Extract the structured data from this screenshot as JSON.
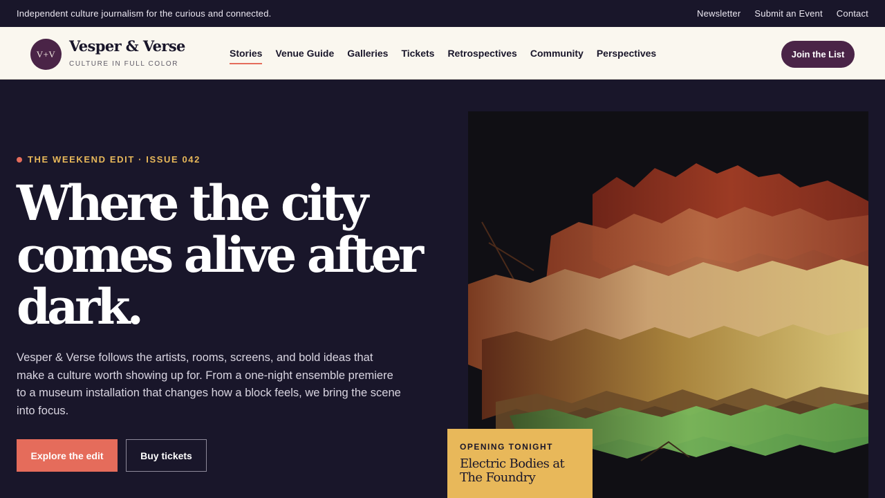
{
  "topbar": {
    "tagline": "Independent culture journalism for the curious and connected.",
    "links": [
      "Newsletter",
      "Submit an Event",
      "Contact"
    ]
  },
  "brand": {
    "monogram": "V+V",
    "name": "Vesper & Verse",
    "tagline": "CULTURE IN FULL COLOR"
  },
  "nav": {
    "items": [
      "Stories",
      "Venue Guide",
      "Galleries",
      "Tickets",
      "Retrospectives",
      "Community",
      "Perspectives"
    ],
    "active": "Stories",
    "cta": "Join the List"
  },
  "hero": {
    "eyebrow": "THE WEEKEND EDIT · ISSUE 042",
    "headline": "Where the city comes alive after dark.",
    "description": "Vesper & Verse follows the artists, rooms, screens, and bold ideas that make a culture worth showing up for. From a one-night ensemble premiere to a museum installation that changes how a block feels, we bring the scene into focus.",
    "primary_cta": "Explore the edit",
    "secondary_cta": "Buy tickets"
  },
  "feature_card": {
    "label": "OPENING TONIGHT",
    "title": "Electric Bodies at The Foundry"
  },
  "colors": {
    "background": "#19162a",
    "cream": "#faf7ef",
    "plum": "#4a2447",
    "coral": "#e56c5b",
    "gold": "#e8b85a"
  }
}
